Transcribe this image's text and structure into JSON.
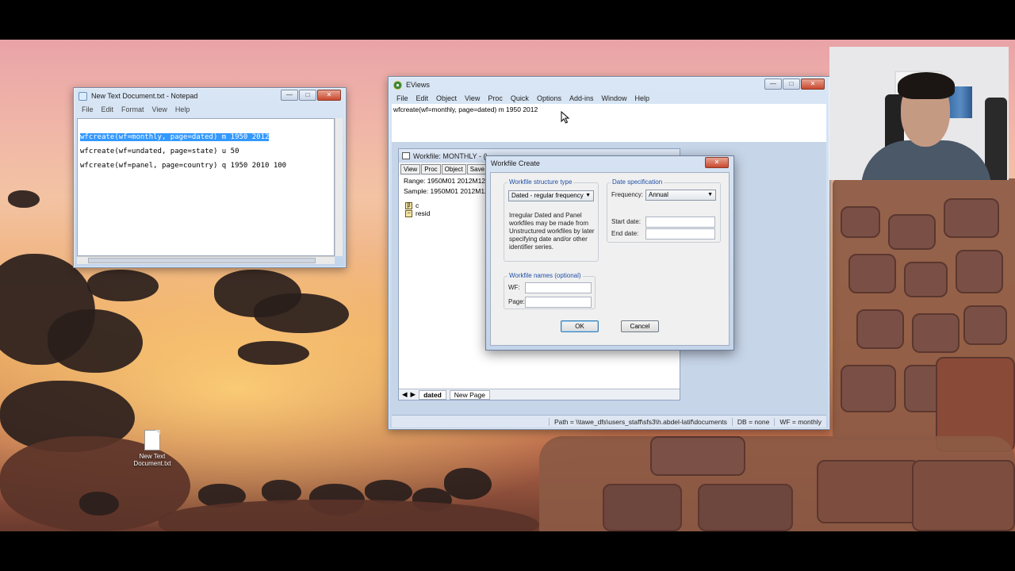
{
  "desktop": {
    "icon_label": "New Text Document.txt"
  },
  "notepad": {
    "title": "New Text Document.txt - Notepad",
    "menu": [
      "File",
      "Edit",
      "Format",
      "View",
      "Help"
    ],
    "lines": [
      "wfcreate(wf=monthly, page=dated) m 1950 2012",
      "wfcreate(wf=undated, page=state) u 50",
      "wfcreate(wf=panel, page=country) q 1950 2010 100"
    ],
    "selected_line_index": 0
  },
  "eviews": {
    "title": "EViews",
    "menu": [
      "File",
      "Edit",
      "Object",
      "View",
      "Proc",
      "Quick",
      "Options",
      "Add-ins",
      "Window",
      "Help"
    ],
    "command": "wfcreate(wf=monthly, page=dated) m 1950 2012",
    "status": {
      "path": "Path = \\\\tawe_dfs\\users_staff\\sfs3\\h.abdel-latif\\documents",
      "db": "DB = none",
      "wf": "WF = monthly"
    }
  },
  "workfile": {
    "title": "Workfile: MONTHLY - (\\",
    "toolbar": [
      "View",
      "Proc",
      "Object",
      "Save",
      "Fr"
    ],
    "range": "Range:  1950M01 2012M12",
    "sample": "Sample: 1950M01 2012M12",
    "objects": [
      {
        "name": "c",
        "icon": "beta-icon"
      },
      {
        "name": "resid",
        "icon": "series-icon"
      }
    ],
    "tabs": [
      "dated",
      "New Page"
    ],
    "active_tab": "dated"
  },
  "dialog": {
    "title": "Workfile Create",
    "structure_group": "Workfile structure type",
    "structure_value": "Dated - regular frequency",
    "structure_note": "Irregular Dated and Panel workfiles may be made from Unstructured workfiles by later specifying date and/or other identifier series.",
    "date_group": "Date specification",
    "frequency_label": "Frequency:",
    "frequency_value": "Annual",
    "start_label": "Start date:",
    "start_value": "",
    "end_label": "End date:",
    "end_value": "",
    "names_group": "Workfile names (optional)",
    "wf_label": "WF:",
    "wf_value": "",
    "page_label": "Page:",
    "page_value": "",
    "ok_label": "OK",
    "cancel_label": "Cancel"
  }
}
